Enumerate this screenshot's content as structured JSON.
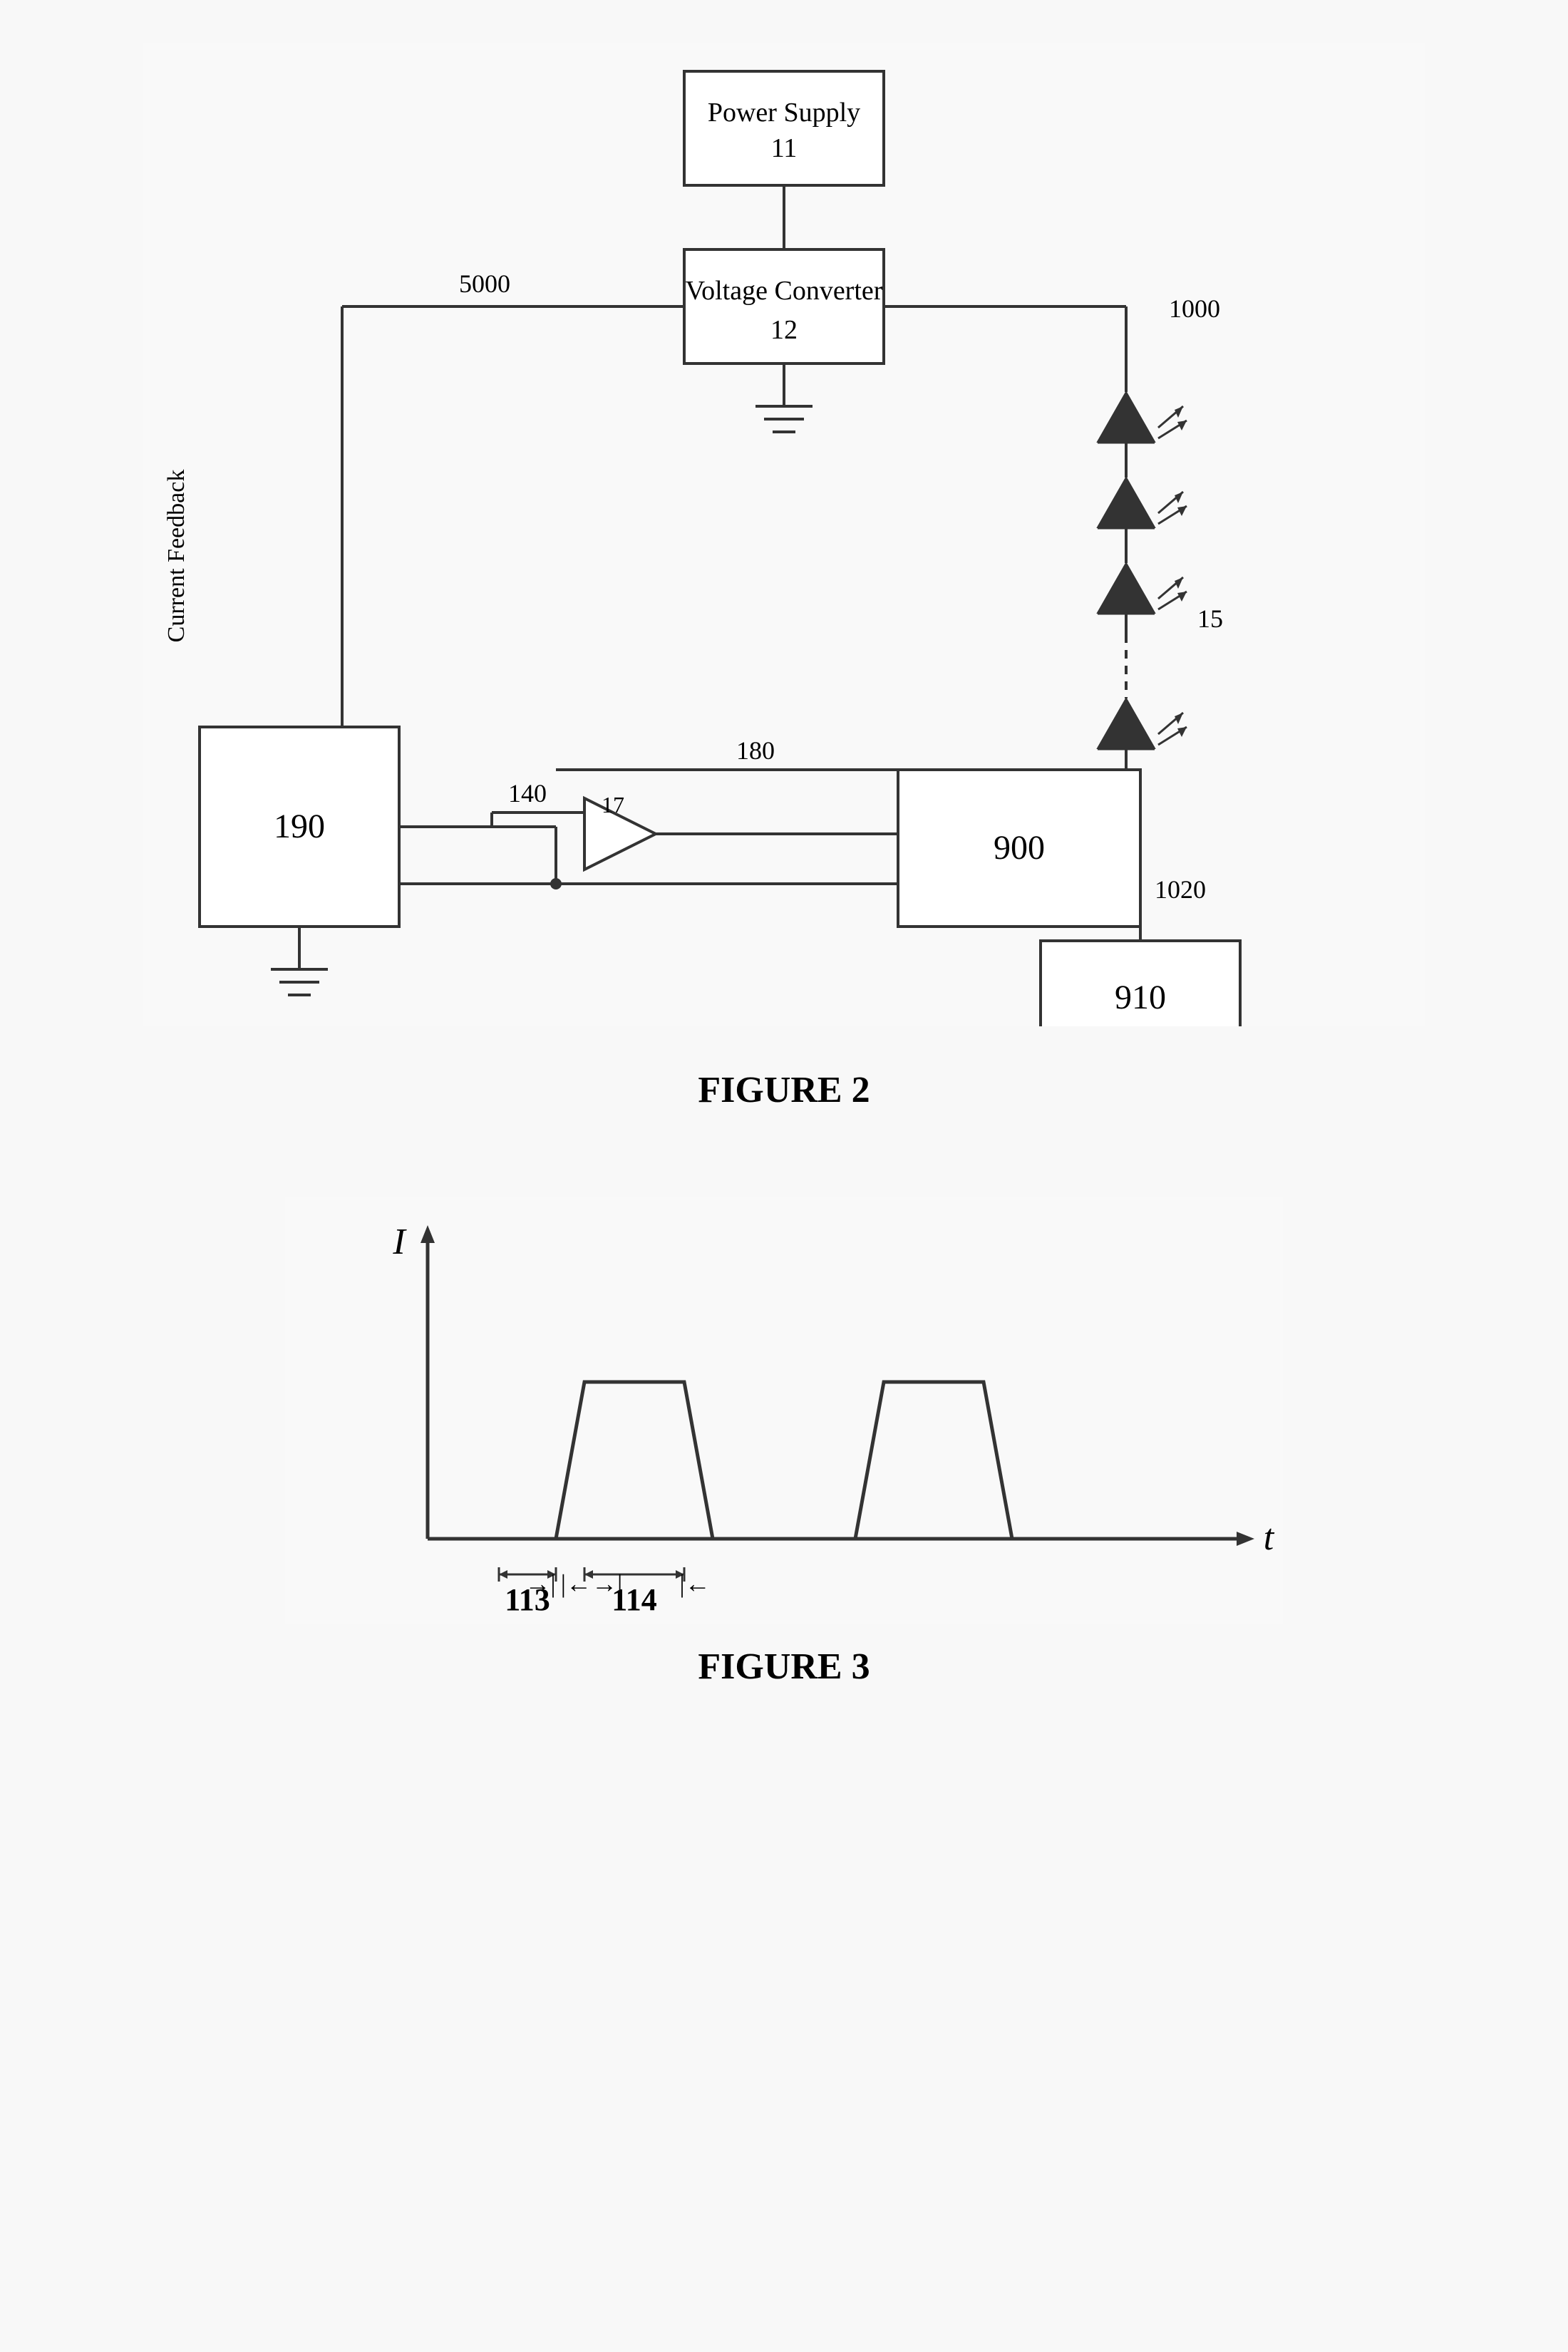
{
  "figure2": {
    "label": "FIGURE 2",
    "components": {
      "power_supply": {
        "label": "Power Supply",
        "number": "11"
      },
      "voltage_converter": {
        "label": "Voltage Converter",
        "number": "12"
      },
      "led_array": {
        "number": "15"
      },
      "amplifier": {
        "number": "17"
      },
      "block_900": {
        "number": "900"
      },
      "block_910": {
        "number": "910"
      },
      "block_190": {
        "number": "190"
      }
    },
    "labels": {
      "n5000": "5000",
      "n1000": "1000",
      "n180": "180",
      "n140": "140",
      "n1020": "1020",
      "current_feedback": "Current Feedback"
    }
  },
  "figure3": {
    "label": "FIGURE 3",
    "axes": {
      "x": "t",
      "y": "I"
    },
    "markers": {
      "m113": "113",
      "m114": "114"
    }
  }
}
